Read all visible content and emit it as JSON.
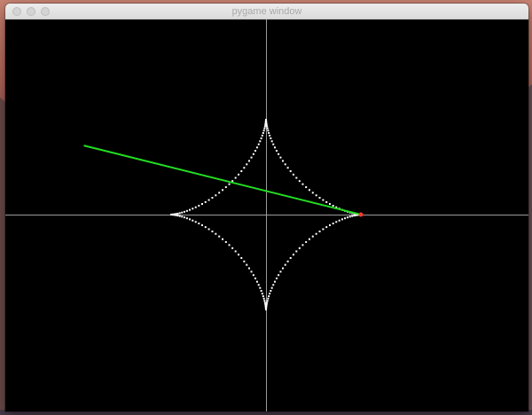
{
  "window": {
    "title": "pygame window",
    "controls": [
      {
        "name": "close-button",
        "icon": "close-dot-icon"
      },
      {
        "name": "minimize-button",
        "icon": "minimize-dot-icon"
      },
      {
        "name": "maximize-button",
        "icon": "maximize-dot-icon"
      }
    ]
  },
  "scene": {
    "background_color": "#000000",
    "axis_color": "#9a9a9a",
    "curve_color": "#ffffff",
    "line_color": "#22dd22",
    "point_color": "#ff3a2a",
    "curve": "astroid",
    "angle_degrees": 0,
    "line_angle_degrees": 166
  }
}
